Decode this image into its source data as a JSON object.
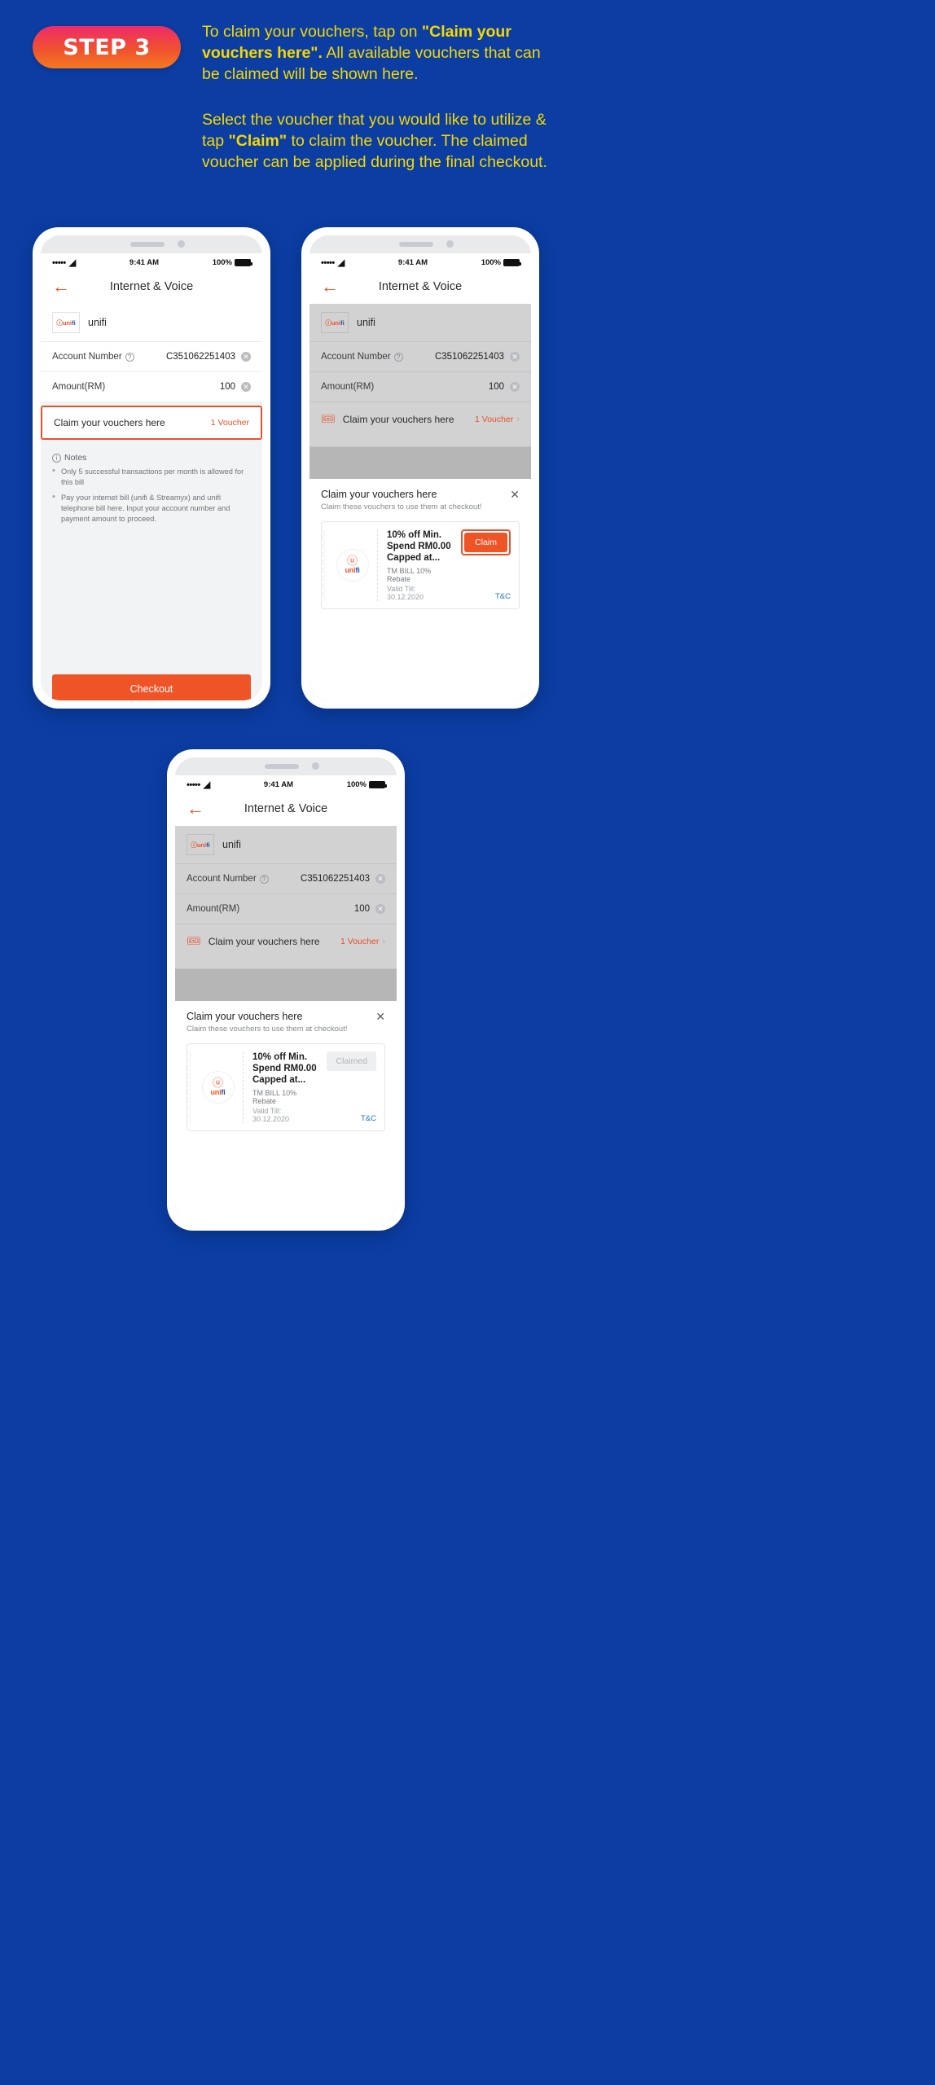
{
  "header": {
    "step_badge": "STEP 3",
    "paragraph1_pre": "To claim your vouchers, tap on ",
    "paragraph1_bold": "\"Claim your vouchers here\".",
    "paragraph1_post": " All available vouchers that can be claimed will be shown here.",
    "paragraph2_pre": "Select the voucher that you would like to utilize & tap ",
    "paragraph2_bold": "\"Claim\"",
    "paragraph2_post": " to claim the voucher. The claimed voucher can be applied during the final checkout."
  },
  "status_bar": {
    "signal": "•••••",
    "wifi_icon": "wifi-icon",
    "time": "9:41 AM",
    "battery": "100%"
  },
  "nav": {
    "back_icon": "back-arrow-icon",
    "title": "Internet & Voice"
  },
  "form": {
    "brand_logo": "unifi",
    "brand_logo_prefix": "uni",
    "brand_logo_suffix": "fi",
    "brand_name": "unifi",
    "account_label": "Account Number",
    "account_value": "C351062251403",
    "amount_label": "Amount(RM)",
    "amount_value": "100",
    "voucher_row_label": "Claim your vouchers here",
    "voucher_row_count": "1 Voucher",
    "chevron": "›"
  },
  "notes": {
    "title": "Notes",
    "items": [
      "Only 5 successful transactions per month is allowed for this bill",
      "Pay your internet bill (unifi & Streamyx) and unifi telephone bill here. Input your account number and payment amount to proceed."
    ]
  },
  "checkout": {
    "label": "Checkout"
  },
  "sheet": {
    "title": "Claim your vouchers here",
    "subtitle": "Claim these vouchers to use them at checkout!",
    "close_icon": "close-icon",
    "voucher": {
      "logo_face": "ⓤ",
      "logo_word_pre": "uni",
      "logo_word_post": "fi",
      "title": "10% off Min. Spend RM0.00 Capped at...",
      "subtitle": "TM BILL 10% Rebate",
      "valid": "Valid Till: 30.12.2020",
      "tnc": "T&C"
    },
    "claim_label": "Claim",
    "claimed_label": "Claimed"
  },
  "colors": {
    "background": "#0b3da3",
    "accent_yellow": "#f5d800",
    "accent_orange": "#ee5426",
    "link_blue": "#1f6fd6"
  }
}
